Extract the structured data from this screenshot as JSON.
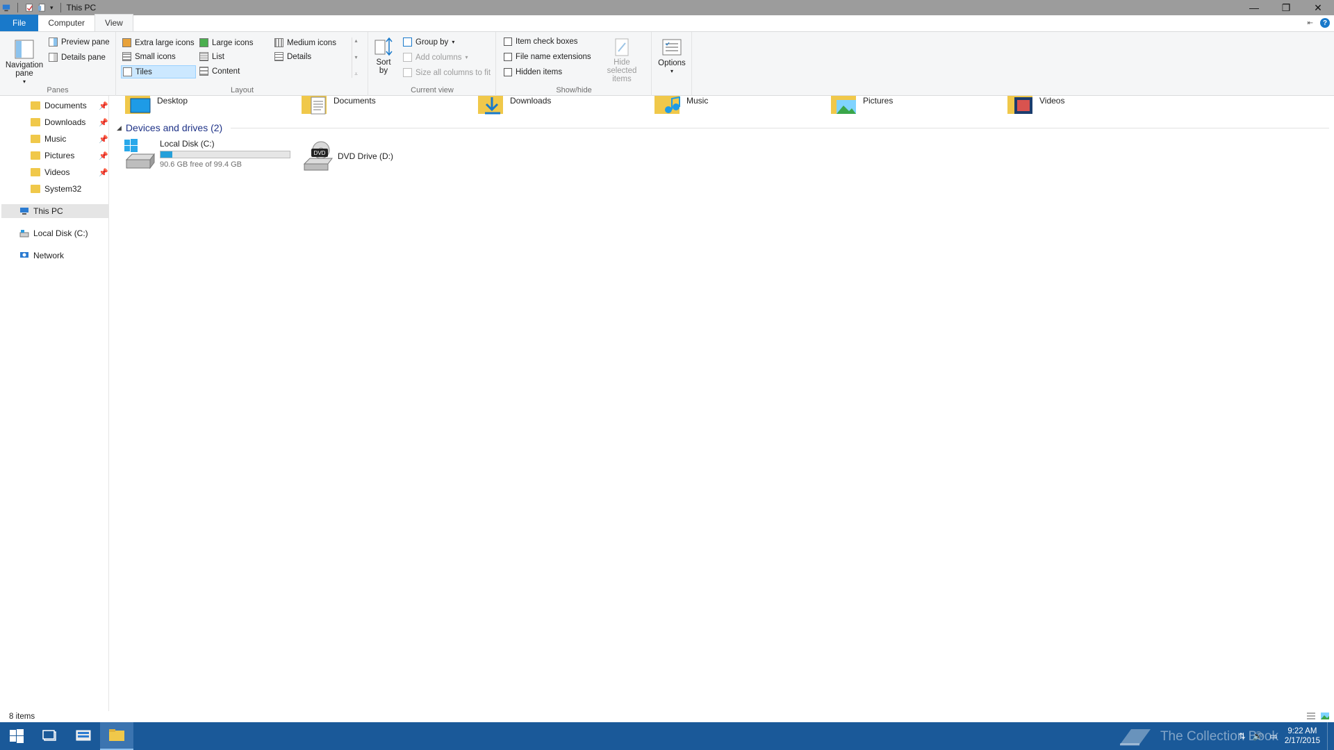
{
  "window": {
    "title": "This PC"
  },
  "tabs": [
    {
      "label": "File"
    },
    {
      "label": "Computer"
    },
    {
      "label": "View"
    }
  ],
  "ribbon": {
    "panes": {
      "navigation_pane": "Navigation pane",
      "preview_pane": "Preview pane",
      "details_pane": "Details pane",
      "group_label": "Panes"
    },
    "layout": {
      "extra_large_icons": "Extra large icons",
      "large_icons": "Large icons",
      "medium_icons": "Medium icons",
      "small_icons": "Small icons",
      "list": "List",
      "details": "Details",
      "tiles": "Tiles",
      "content": "Content",
      "group_label": "Layout",
      "selected": "Tiles"
    },
    "current_view": {
      "sort_by": "Sort by",
      "group_by": "Group by",
      "add_columns": "Add columns",
      "size_all_columns": "Size all columns to fit",
      "group_label": "Current view"
    },
    "show_hide": {
      "item_check_boxes": "Item check boxes",
      "file_name_extensions": "File name extensions",
      "hidden_items": "Hidden items",
      "hide_selected_items": "Hide selected items",
      "group_label": "Show/hide"
    },
    "options": {
      "label": "Options"
    }
  },
  "nav": {
    "quick_access": [
      {
        "label": "Documents",
        "icon": "documents-folder-icon",
        "pinned": true
      },
      {
        "label": "Downloads",
        "icon": "downloads-folder-icon",
        "pinned": true
      },
      {
        "label": "Music",
        "icon": "music-folder-icon",
        "pinned": true
      },
      {
        "label": "Pictures",
        "icon": "pictures-folder-icon",
        "pinned": true
      },
      {
        "label": "Videos",
        "icon": "videos-folder-icon",
        "pinned": true
      },
      {
        "label": "System32",
        "icon": "folder-icon",
        "pinned": false
      }
    ],
    "this_pc": "This PC",
    "local_disk": "Local Disk (C:)",
    "network": "Network"
  },
  "content": {
    "folders": [
      {
        "label": "Desktop",
        "icon": "desktop-folder-icon"
      },
      {
        "label": "Documents",
        "icon": "documents-folder-icon"
      },
      {
        "label": "Downloads",
        "icon": "downloads-folder-icon"
      },
      {
        "label": "Music",
        "icon": "music-folder-icon"
      },
      {
        "label": "Pictures",
        "icon": "pictures-folder-icon"
      },
      {
        "label": "Videos",
        "icon": "videos-folder-icon"
      }
    ],
    "devices_section": "Devices and drives (2)",
    "drives": [
      {
        "label": "Local Disk (C:)",
        "free_text": "90.6 GB free of 99.4 GB",
        "used_fraction": 0.089
      },
      {
        "label": "DVD Drive (D:)",
        "badge": "DVD"
      }
    ]
  },
  "status": {
    "items": "8 items"
  },
  "taskbar": {
    "time": "9:22 AM",
    "date": "2/17/2015",
    "watermark": "The Collection Book"
  },
  "colors": {
    "accent": "#1979ca",
    "taskbar": "#1a5999",
    "drive_bar": "#26a0da",
    "section_title": "#1e3287"
  }
}
